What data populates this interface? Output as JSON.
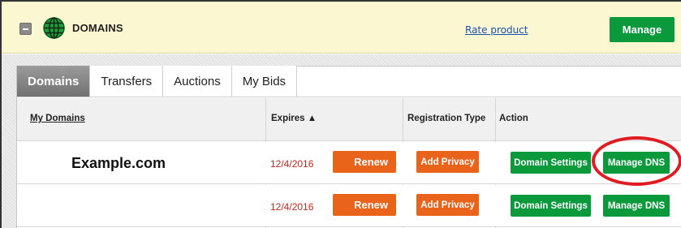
{
  "header": {
    "title": "DOMAINS",
    "rate_link": "Rate product",
    "manage_label": "Manage"
  },
  "tabs": [
    {
      "label": "Domains",
      "active": true
    },
    {
      "label": "Transfers",
      "active": false
    },
    {
      "label": "Auctions",
      "active": false
    },
    {
      "label": "My Bids",
      "active": false
    }
  ],
  "table": {
    "columns": {
      "domains": "My Domains",
      "expires": "Expires ▲",
      "registration_type": "Registration Type",
      "action": "Action"
    },
    "rows": [
      {
        "domain": "Example.com",
        "expires": "12/4/2016",
        "renew": "Renew",
        "add_privacy": "Add Privacy",
        "domain_settings": "Domain Settings",
        "manage_dns": "Manage DNS"
      },
      {
        "domain": "",
        "expires": "12/4/2016",
        "renew": "Renew",
        "add_privacy": "Add Privacy",
        "domain_settings": "Domain Settings",
        "manage_dns": "Manage DNS"
      }
    ]
  },
  "colors": {
    "header_bg": "#fbf8d1",
    "green": "#0a9a3c",
    "orange": "#e9631a",
    "expiry_red": "#c0271d",
    "highlight_red": "#e01b22"
  },
  "icons": {
    "collapse": "minus-box-icon",
    "domains": "globe-icon"
  }
}
